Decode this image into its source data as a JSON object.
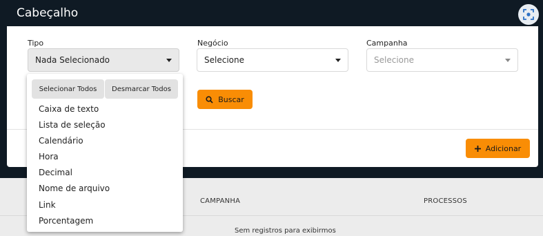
{
  "window": {
    "title": "Cabeçalho"
  },
  "filters": {
    "tipo": {
      "label": "Tipo",
      "value": "Nada Selecionado"
    },
    "negocio": {
      "label": "Negócio",
      "value": "Selecione"
    },
    "campanha": {
      "label": "Campanha",
      "value": "Selecione"
    }
  },
  "buttons": {
    "search": "Buscar",
    "add": "Adicionar"
  },
  "dropdown": {
    "select_all": "Selecionar Todos",
    "deselect_all": "Desmarcar Todos",
    "items": [
      "Caixa de texto",
      "Lista de seleção",
      "Calendário",
      "Hora",
      "Decimal",
      "Nome de arquivo",
      "Link",
      "Porcentagem"
    ]
  },
  "background_table": {
    "columns": [
      "CAMPANHA",
      "PROCESSOS"
    ],
    "empty_message": "Sem registros para exibirmos"
  },
  "colors": {
    "header_bg": "#0f1a24",
    "accent": "#f98d05"
  },
  "icons": {
    "expand": "focus-expand-icon",
    "search": "search-icon",
    "add": "plus-icon"
  }
}
